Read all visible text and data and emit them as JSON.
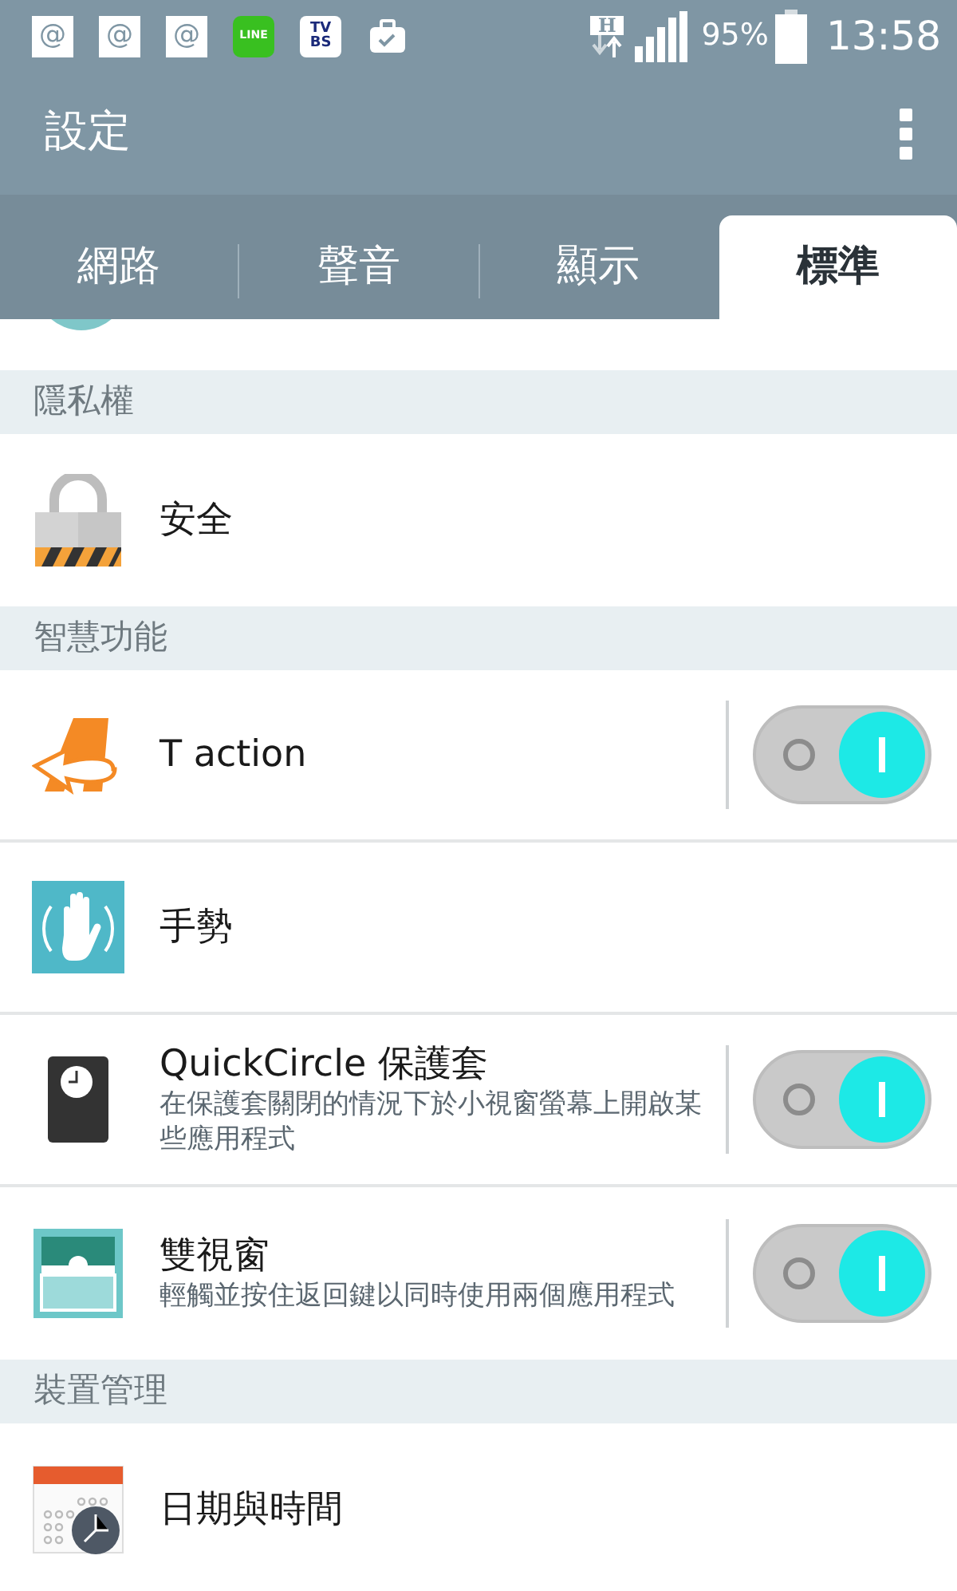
{
  "status_bar": {
    "notifications": [
      {
        "kind": "at",
        "label": "@"
      },
      {
        "kind": "at",
        "label": "@"
      },
      {
        "kind": "at",
        "label": "@"
      },
      {
        "kind": "line",
        "label": "LINE"
      },
      {
        "kind": "tvbs",
        "label": "TV",
        "label2": "BS"
      },
      {
        "kind": "briefcase"
      }
    ],
    "network": "H",
    "battery": "95%",
    "time": "13:58"
  },
  "toolbar": {
    "title": "設定"
  },
  "tabs": [
    {
      "label": "網路",
      "selected": false
    },
    {
      "label": "聲音",
      "selected": false
    },
    {
      "label": "顯示",
      "selected": false
    },
    {
      "label": "標準",
      "selected": true
    }
  ],
  "list": [
    {
      "kind": "header",
      "title": "隱私權"
    },
    {
      "kind": "item",
      "title": "安全"
    },
    {
      "kind": "header",
      "title": "智慧功能"
    },
    {
      "kind": "item",
      "title": "T action",
      "on": true
    },
    {
      "kind": "item",
      "title": "手勢"
    },
    {
      "kind": "item",
      "title": "QuickCircle 保護套",
      "subtitle": "在保護套關閉的情況下於小視窗螢幕上開啟某些應用程式",
      "on": true
    },
    {
      "kind": "item",
      "title": "雙視窗",
      "subtitle": "輕觸並按住返回鍵以同時使用兩個應用程式",
      "on": true
    },
    {
      "kind": "header",
      "title": "裝置管理"
    },
    {
      "kind": "item",
      "title": "日期與時間"
    }
  ]
}
